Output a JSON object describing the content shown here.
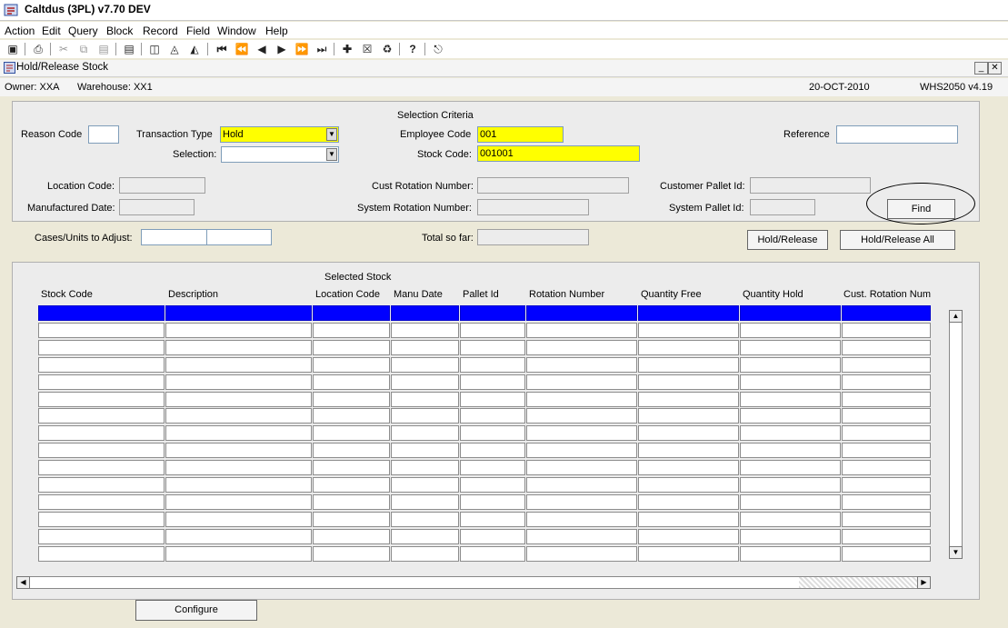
{
  "app": {
    "title": "Caltdus (3PL) v7.70 DEV"
  },
  "menu": [
    "Action",
    "Edit",
    "Query",
    "Block",
    "Record",
    "Field",
    "Window",
    "Help"
  ],
  "window": {
    "title": "Hold/Release Stock",
    "owner": "Owner: XXA",
    "warehouse": "Warehouse: XX1",
    "date": "20-OCT-2010",
    "form_id": "WHS2050 v4.19"
  },
  "criteria": {
    "heading": "Selection Criteria",
    "reason_code_label": "Reason Code",
    "reason_code_value": "",
    "transaction_type_label": "Transaction Type",
    "transaction_type_value": "Hold",
    "selection_label": "Selection:",
    "selection_value": "",
    "employee_code_label": "Employee Code",
    "employee_code_value": "001",
    "stock_code_label": "Stock Code:",
    "stock_code_value": "001001",
    "reference_label": "Reference",
    "reference_value": "",
    "location_code_label": "Location Code:",
    "cust_rotation_label": "Cust Rotation Number:",
    "customer_pallet_label": "Customer Pallet Id:",
    "manufactured_date_label": "Manufactured Date:",
    "system_rotation_label": "System Rotation Number:",
    "system_pallet_label": "System Pallet Id:",
    "find_button": "Find"
  },
  "adjust": {
    "cases_label": "Cases/Units to Adjust:",
    "total_label": "Total so far:",
    "hold_release_button": "Hold/Release",
    "hold_release_all_button": "Hold/Release All"
  },
  "grid": {
    "heading": "Selected Stock",
    "columns": [
      "Stock Code",
      "Description",
      "Location Code",
      "Manu Date",
      "Pallet Id",
      "Rotation Number",
      "Quantity Free",
      "Quantity Hold",
      "Cust. Rotation Num"
    ]
  },
  "footer": {
    "configure_button": "Configure"
  }
}
